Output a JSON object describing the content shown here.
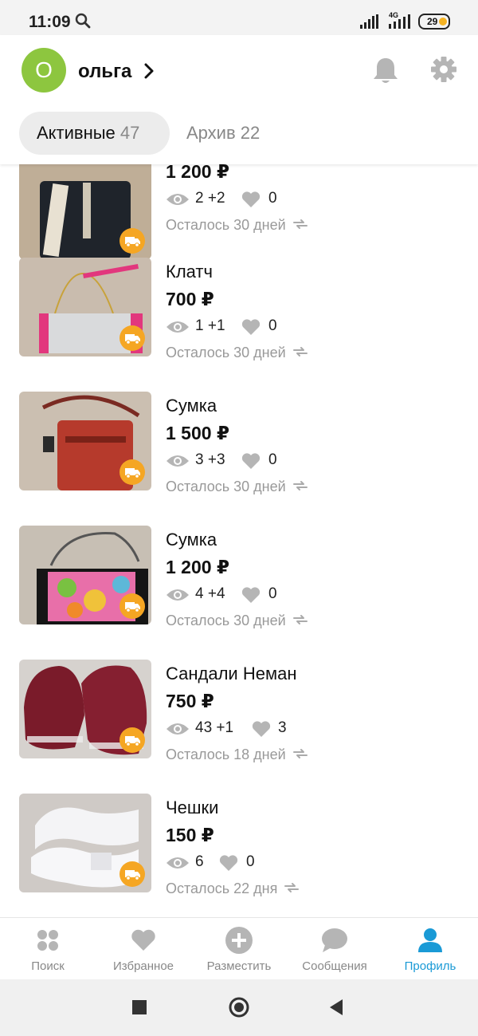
{
  "status_bar": {
    "time": "11:09",
    "network": "4G",
    "battery": "29"
  },
  "user": {
    "initial": "О",
    "name": "ольга"
  },
  "tabs": [
    {
      "label": "Активные",
      "count": "47"
    },
    {
      "label": "Архив",
      "count": "22"
    }
  ],
  "listings": [
    {
      "title": "",
      "price": "1 200 ₽",
      "views": "2 +2",
      "likes": "0",
      "expiry": "Осталось 30 дней"
    },
    {
      "title": "Клатч",
      "price": "700 ₽",
      "views": "1 +1",
      "likes": "0",
      "expiry": "Осталось 30 дней"
    },
    {
      "title": "Сумка",
      "price": "1 500 ₽",
      "views": "3 +3",
      "likes": "0",
      "expiry": "Осталось 30 дней"
    },
    {
      "title": "Сумка",
      "price": "1 200 ₽",
      "views": "4 +4",
      "likes": "0",
      "expiry": "Осталось 30 дней"
    },
    {
      "title": "Сандали Неман",
      "price": "750 ₽",
      "views": "43 +1",
      "likes": "3",
      "expiry": "Осталось 18 дней"
    },
    {
      "title": "Чешки",
      "price": "150 ₽",
      "views": "6",
      "likes": "0",
      "expiry": "Осталось 22 дня"
    }
  ],
  "bottom_nav": [
    {
      "label": "Поиск",
      "icon": "search-dots-icon"
    },
    {
      "label": "Избранное",
      "icon": "heart-icon"
    },
    {
      "label": "Разместить",
      "icon": "plus-circle-icon"
    },
    {
      "label": "Сообщения",
      "icon": "chat-bubble-icon"
    },
    {
      "label": "Профиль",
      "icon": "profile-icon",
      "active": true
    }
  ],
  "colors": {
    "accent": "#1a9ad6",
    "avatar": "#8dc63f",
    "delivery_badge": "#f5a623",
    "icon_gray": "#b5b5b5"
  }
}
